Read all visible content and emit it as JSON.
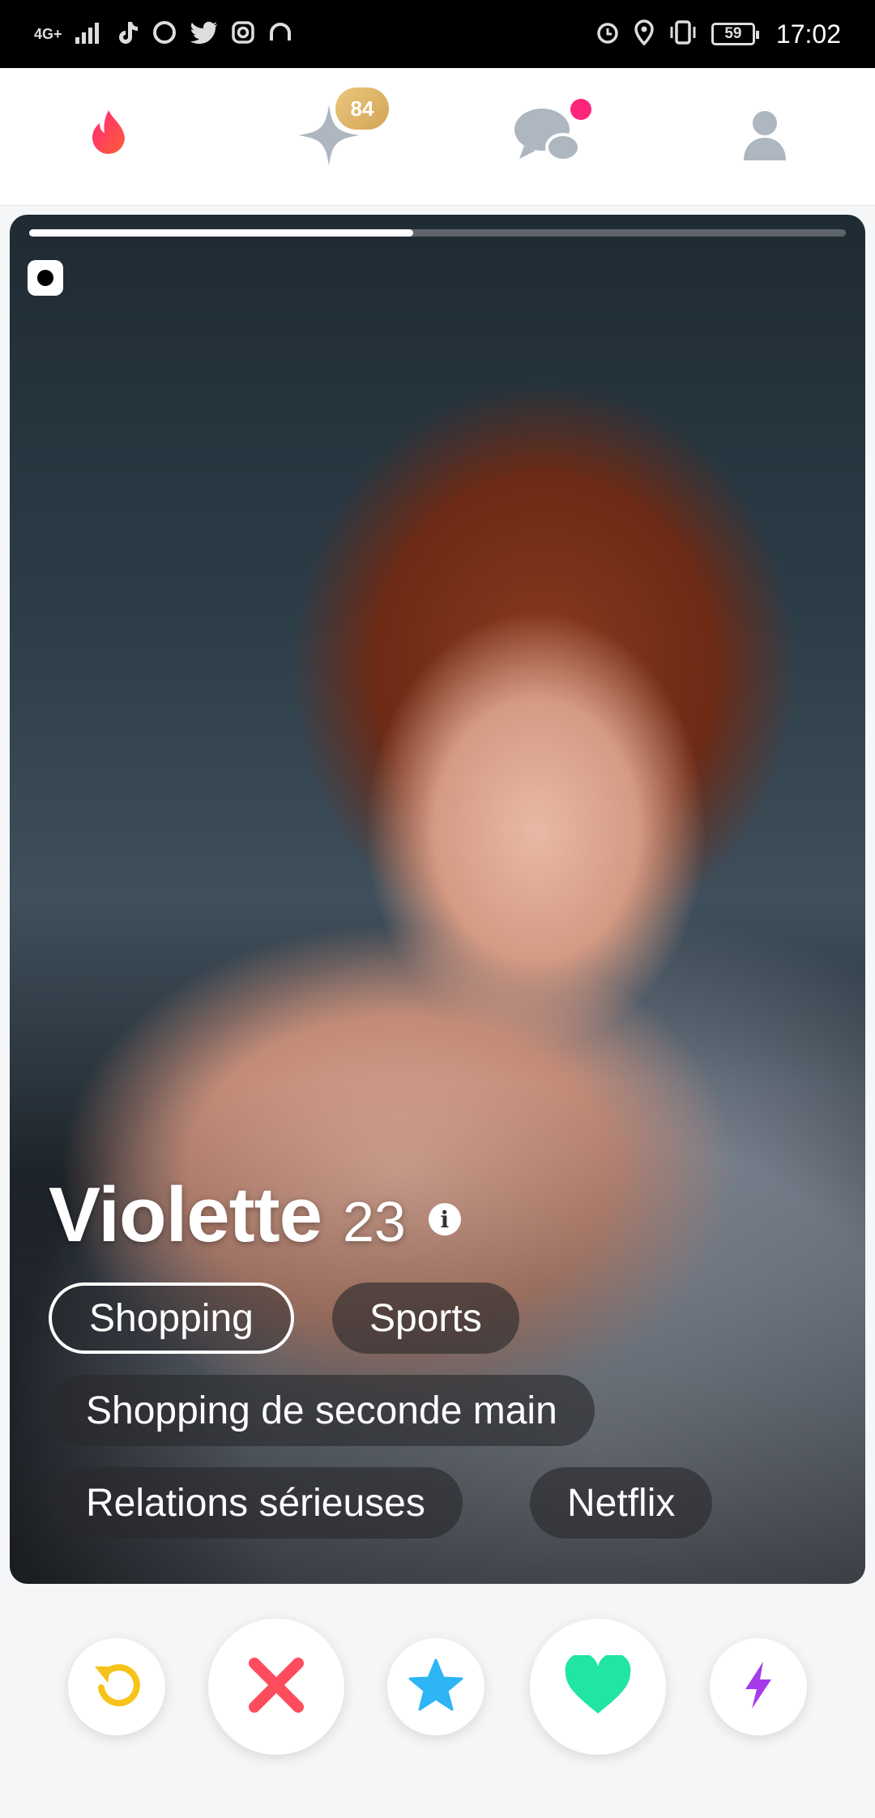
{
  "status_bar": {
    "network": "4G+",
    "battery": "59",
    "time": "17:02",
    "left_icons": [
      "signal-icon",
      "tiktok-icon",
      "sync-icon",
      "twitter-icon",
      "instagram-icon",
      "headphones-icon"
    ],
    "right_icons": [
      "alarm-icon",
      "location-icon",
      "vibrate-icon",
      "battery-icon"
    ]
  },
  "nav": {
    "items": [
      "flame-icon",
      "sparkle-icon",
      "chat-icon",
      "profile-icon"
    ],
    "top_picks_count": "84",
    "accent_color": "#fd267a",
    "gold_color": "#d4a556"
  },
  "profile": {
    "name": "Violette",
    "age": "23",
    "photo_progress": 0.47,
    "tags": [
      {
        "label": "Shopping",
        "highlighted": true
      },
      {
        "label": "Sports",
        "highlighted": false
      },
      {
        "label": "Shopping de seconde main",
        "highlighted": false
      },
      {
        "label": "Relations sérieuses",
        "highlighted": false
      },
      {
        "label": "Netflix",
        "highlighted": false
      }
    ]
  },
  "actions": [
    {
      "name": "rewind-button",
      "icon": "undo-icon",
      "color": "#f7c31a"
    },
    {
      "name": "nope-button",
      "icon": "close-icon",
      "color": "#fd4d5c"
    },
    {
      "name": "super-like-button",
      "icon": "star-icon",
      "color": "#2db5f5"
    },
    {
      "name": "like-button",
      "icon": "heart-icon",
      "color": "#21e5a2"
    },
    {
      "name": "boost-button",
      "icon": "lightning-icon",
      "color": "#a53aed"
    }
  ]
}
